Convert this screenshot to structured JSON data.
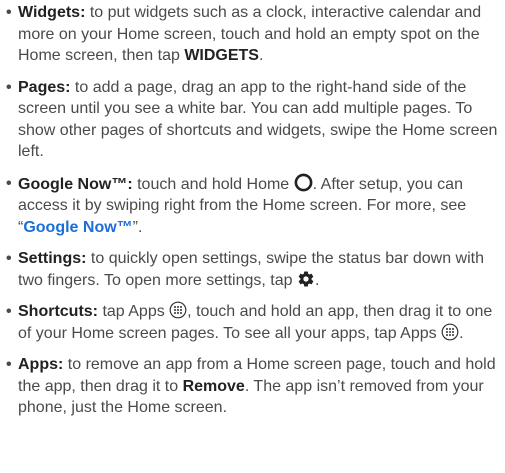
{
  "items": [
    {
      "term": "Widgets:",
      "text1": " to put widgets such as a clock, interactive calendar and more on your Home screen, touch and hold an empty spot on the Home screen, then tap ",
      "bold1": "WIDGETS",
      "text2": "."
    },
    {
      "term": "Pages:",
      "text1": " to add a page, drag an app to the right-hand side of the screen until you see a white bar. You can add multiple pages. To show other pages of shortcuts and widgets, swipe the Home screen left."
    },
    {
      "term": "Google Now™:",
      "text1": " touch and hold Home ",
      "text2": ". After setup, you can access it by swiping right from the Home screen. For more, see “",
      "link": "Google Now™",
      "text3": "”."
    },
    {
      "term": "Settings:",
      "text1": " to quickly open settings, swipe the status bar down with two fingers. To open more settings, tap ",
      "text2": "."
    },
    {
      "term": "Shortcuts:",
      "text1": " tap Apps ",
      "text2": ", touch and hold an app, then drag it to one of your Home screen pages. To see all your apps, tap Apps ",
      "text3": "."
    },
    {
      "term": "Apps:",
      "text1": " to remove an app from a Home screen page, touch and hold the app, then drag it to ",
      "bold1": "Remove",
      "text2": ". The app isn’t removed from your phone, just the Home screen."
    }
  ],
  "bullet": "•",
  "icons": {
    "home": "home-circle-icon",
    "settings": "gear-icon",
    "apps": "apps-grid-icon"
  },
  "colors": {
    "text": "#4a4a4a",
    "term": "#222222",
    "link": "#1c6ed8"
  }
}
